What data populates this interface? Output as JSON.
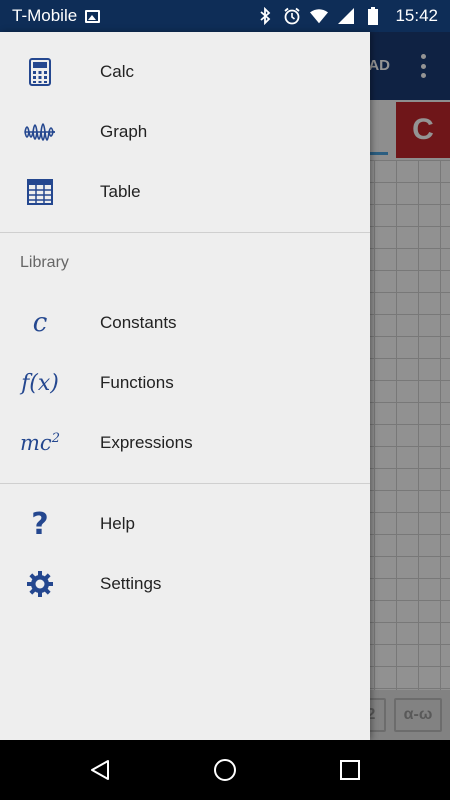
{
  "status_bar": {
    "carrier": "T-Mobile",
    "time": "15:42",
    "icons": [
      "gallery-icon",
      "bluetooth-icon",
      "alarm-icon",
      "wifi-icon",
      "signal-icon",
      "battery-icon"
    ]
  },
  "app_background": {
    "toolbar_mode": "AD",
    "clear_button": "C",
    "keypad_partial": [
      "2",
      "α-ω"
    ]
  },
  "drawer": {
    "items": [
      {
        "label": "Calc",
        "icon": "calculator-icon"
      },
      {
        "label": "Graph",
        "icon": "graph-wave-icon"
      },
      {
        "label": "Table",
        "icon": "table-icon"
      }
    ],
    "library_header": "Library",
    "library_items": [
      {
        "label": "Constants",
        "icon": "constants-c-icon",
        "glyph": "c"
      },
      {
        "label": "Functions",
        "icon": "function-fx-icon",
        "glyph": "f(x)"
      },
      {
        "label": "Expressions",
        "icon": "expression-mc2-icon",
        "glyph": "mc",
        "glyph_sup": "2"
      }
    ],
    "bottom_items": [
      {
        "label": "Help",
        "icon": "question-mark-icon",
        "glyph": "?"
      },
      {
        "label": "Settings",
        "icon": "gear-icon"
      }
    ]
  },
  "nav_bar": {
    "buttons": [
      "back-icon",
      "home-icon",
      "recents-icon"
    ]
  },
  "colors": {
    "status_bar": "#0e2d57",
    "toolbar": "#1a3c74",
    "accent_icon": "#24478f",
    "clear_button": "#c0262b",
    "drawer_bg": "#eeeeee"
  }
}
